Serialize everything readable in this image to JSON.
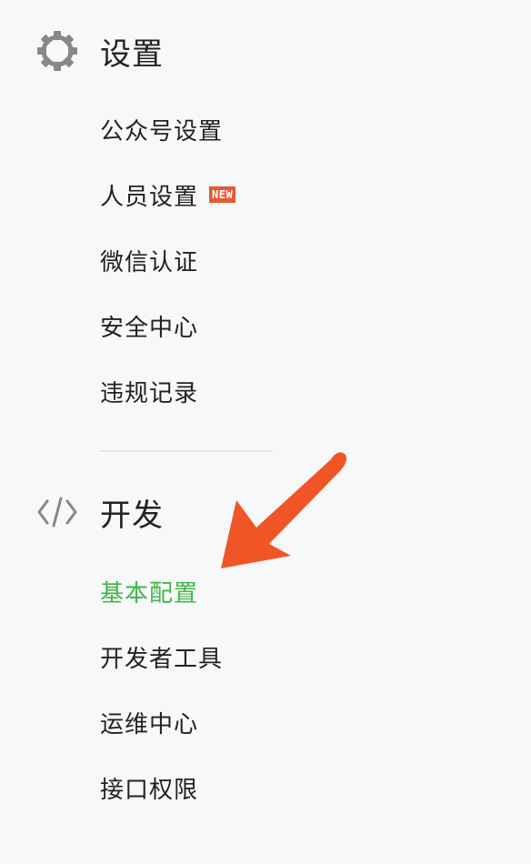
{
  "settings": {
    "title": "设置",
    "icon": "gear-icon",
    "items": [
      {
        "label": "公众号设置"
      },
      {
        "label": "人员设置",
        "badge": "NEW"
      },
      {
        "label": "微信认证"
      },
      {
        "label": "安全中心"
      },
      {
        "label": "违规记录"
      }
    ]
  },
  "dev": {
    "title": "开发",
    "icon": "code-icon",
    "items": [
      {
        "label": "基本配置",
        "active": true
      },
      {
        "label": "开发者工具"
      },
      {
        "label": "运维中心"
      },
      {
        "label": "接口权限"
      }
    ]
  },
  "colors": {
    "active": "#44b549",
    "badge": "#e65a2e",
    "arrow": "#ef5527"
  }
}
